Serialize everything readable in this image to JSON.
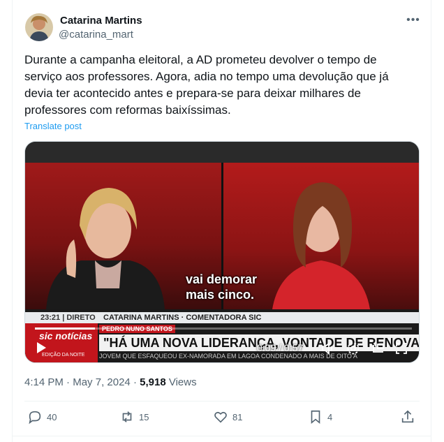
{
  "author": {
    "name": "Catarina Martins",
    "handle": "@catarina_mart"
  },
  "post": {
    "text": "Durante a campanha eleitoral, a AD prometeu devolver o tempo de serviço aos professores. Agora, adia no tempo uma devolução que já devia ter acontecido antes e prepara-se para deixar milhares de professores com reformas baixíssimas.",
    "translate_label": "Translate post"
  },
  "video": {
    "subtitle_line1": "vai demorar",
    "subtitle_line2": "mais cinco.",
    "clock": "23:21",
    "live_label": "DIRETO",
    "lower_third": "CATARINA MARTINS · COMENTADORA SIC",
    "channel_logo": "sic notícias",
    "channel_sub": "EDIÇÃO DA NOITE",
    "red_tag": "PEDRO NUNO SANTOS",
    "headline": "\"HÁ UMA NOVA LIDERANÇA, VONTADE DE RENOVAR\"",
    "ticker": "JOVEM QUE ESFAQUEOU EX-NAMORADA EM LAGOA CONDENADO A MAIS DE OITO A",
    "time_display": "0:09 / 0:57",
    "progress": 0.16
  },
  "meta": {
    "time": "4:14 PM",
    "date": "May 7, 2024",
    "views": "5,918",
    "views_label": "Views"
  },
  "actions": {
    "replies": "40",
    "reposts": "15",
    "likes": "81",
    "bookmarks": "4"
  },
  "colors": {
    "link": "#1d9bf0",
    "muted": "#536471",
    "sic_red": "#c2151c"
  },
  "icons": [
    "more-icon",
    "reply-icon",
    "repost-icon",
    "like-icon",
    "bookmark-icon",
    "share-icon",
    "play-icon",
    "volume-icon",
    "settings-icon",
    "fullscreen-icon",
    "pip-icon"
  ]
}
